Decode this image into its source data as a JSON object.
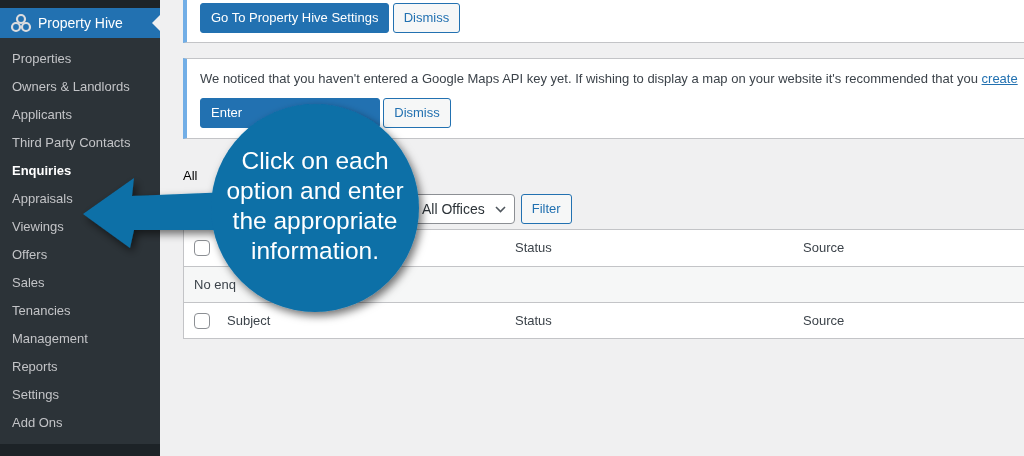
{
  "sidebar": {
    "title": "Property Hive",
    "items": [
      {
        "label": "Properties",
        "selected": false
      },
      {
        "label": "Owners & Landlords",
        "selected": false
      },
      {
        "label": "Applicants",
        "selected": false
      },
      {
        "label": "Third Party Contacts",
        "selected": false
      },
      {
        "label": "Enquiries",
        "selected": true
      },
      {
        "label": "Appraisals",
        "selected": false
      },
      {
        "label": "Viewings",
        "selected": false
      },
      {
        "label": "Offers",
        "selected": false
      },
      {
        "label": "Sales",
        "selected": false
      },
      {
        "label": "Tenancies",
        "selected": false
      },
      {
        "label": "Management",
        "selected": false
      },
      {
        "label": "Reports",
        "selected": false
      },
      {
        "label": "Settings",
        "selected": false
      },
      {
        "label": "Add Ons",
        "selected": false
      }
    ]
  },
  "notices": [
    {
      "buttons": [
        {
          "label": "Go To Property Hive Settings",
          "kind": "primary"
        },
        {
          "label": "Dismiss",
          "kind": "secondary"
        }
      ]
    },
    {
      "text": "We noticed that you haven't entered a Google Maps API key yet. If wishing to display a map on your website it's recommended that you",
      "link": "create",
      "buttons": [
        {
          "label": "Enter",
          "kind": "primary"
        },
        {
          "label": "Dismiss",
          "kind": "secondary"
        }
      ]
    }
  ],
  "views": "All",
  "filters": {
    "office": "All Offices",
    "button": "Filter"
  },
  "table": {
    "header_row": {
      "checked": false,
      "cells": [
        "",
        "Status",
        "Source"
      ]
    },
    "empty_message": "No enq",
    "footer_row": {
      "checked": false,
      "cells": [
        "Subject",
        "Status",
        "Source"
      ]
    }
  },
  "callout": {
    "text": "Click on each option and enter the appropriate information."
  }
}
